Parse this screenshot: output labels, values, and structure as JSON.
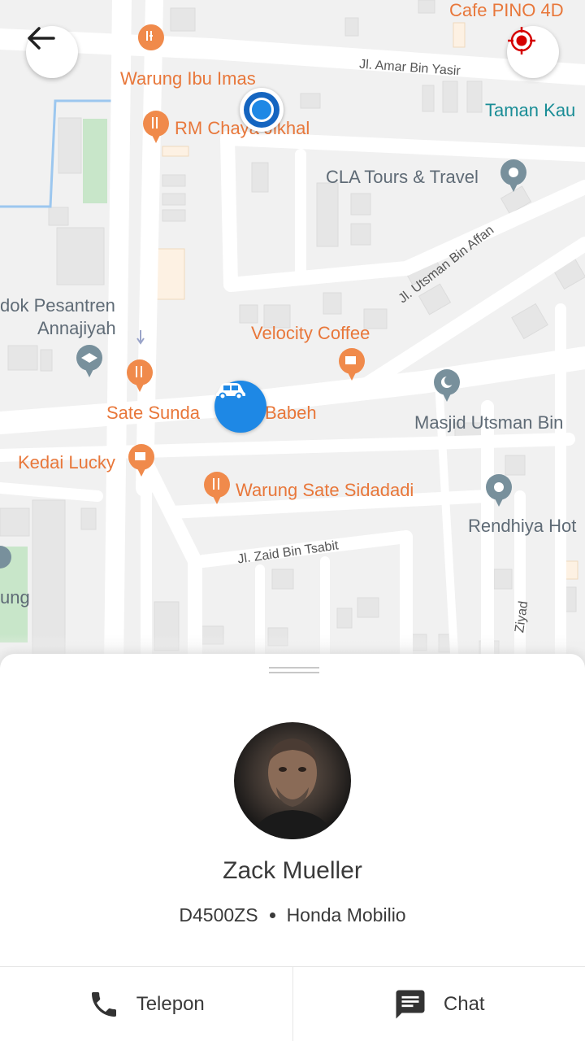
{
  "map": {
    "labels": {
      "cafe_pino": "Cafe PINO 4D",
      "warung_ibu_imas": "Warung Ibu Imas",
      "jl_amar": "Jl. Amar Bin Yasir",
      "taman_kau": "Taman Kau",
      "rm_chaya": "RM Chaya Jikhal",
      "cla_tours": "CLA Tours & Travel",
      "pesantren_1": "dok Pesantren",
      "pesantren_2": "Annajiyah",
      "velocity": "Velocity Coffee",
      "jl_utsman": "Jl. Utsman Bin Affan",
      "masjid": "Masjid Utsman Bin",
      "sate_sunda": "Sate Sunda",
      "babeh": "Babeh",
      "kedai_lucky": "Kedai Lucky",
      "warung_sate": "Warung Sate Sidadadi",
      "rendhiya": "Rendhiya Hot",
      "jl_zaid": "Jl. Zaid Bin Tsabit",
      "ung": "ung",
      "ziyad": "Ziyad"
    }
  },
  "controls": {
    "back_icon": "arrow-left-icon",
    "locate_icon": "crosshair-target-icon"
  },
  "driver": {
    "name": "Zack Mueller",
    "plate": "D4500ZS",
    "car_model": "Honda Mobilio"
  },
  "actions": {
    "call_label": "Telepon",
    "call_icon": "phone-icon",
    "chat_label": "Chat",
    "chat_icon": "chat-icon"
  },
  "colors": {
    "accent_blue": "#1e88e5",
    "target_red": "#d50000",
    "poi_orange": "#e8773a"
  }
}
